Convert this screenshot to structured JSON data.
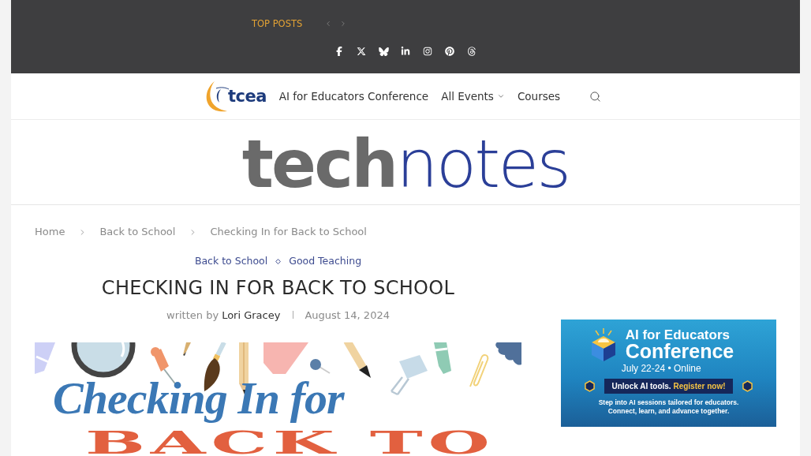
{
  "top_bar": {
    "label": "TOP POSTS",
    "social_links": [
      {
        "kind": "facebook"
      },
      {
        "kind": "x"
      },
      {
        "kind": "bluesky"
      },
      {
        "kind": "linkedin"
      },
      {
        "kind": "instagram"
      },
      {
        "kind": "pinterest"
      },
      {
        "kind": "threads"
      }
    ]
  },
  "nav": {
    "logo_text": "tcea",
    "items": [
      {
        "label": "AI for Educators Conference",
        "has_submenu": false
      },
      {
        "label": "All Events",
        "has_submenu": true
      },
      {
        "label": "Courses",
        "has_submenu": false
      }
    ]
  },
  "masthead": {
    "first": "tech",
    "second": "notes"
  },
  "breadcrumb": [
    "Home",
    "Back to School",
    "Checking In for Back to School"
  ],
  "post": {
    "categories": [
      "Back to School",
      "Good Teaching"
    ],
    "title": "CHECKING IN FOR BACK TO SCHOOL",
    "byline_prefix": "written by",
    "author": "Lori Gracey",
    "date": "August 14, 2024",
    "featured_image": {
      "lines": [
        {
          "kind": "script",
          "text": "Checking In for"
        },
        {
          "kind": "display",
          "text": "BACK TO"
        }
      ]
    }
  },
  "sidebar": {
    "ad_banner": {
      "heading": "AI for Educators",
      "heading_2": "Conference",
      "subheading": "July 22-24 • Online",
      "cta_lead": "Unlock AI tools.",
      "cta_highlight": "Register now!",
      "tagline": "Step into AI sessions tailored for educators. Connect, learn, and advance together."
    }
  }
}
